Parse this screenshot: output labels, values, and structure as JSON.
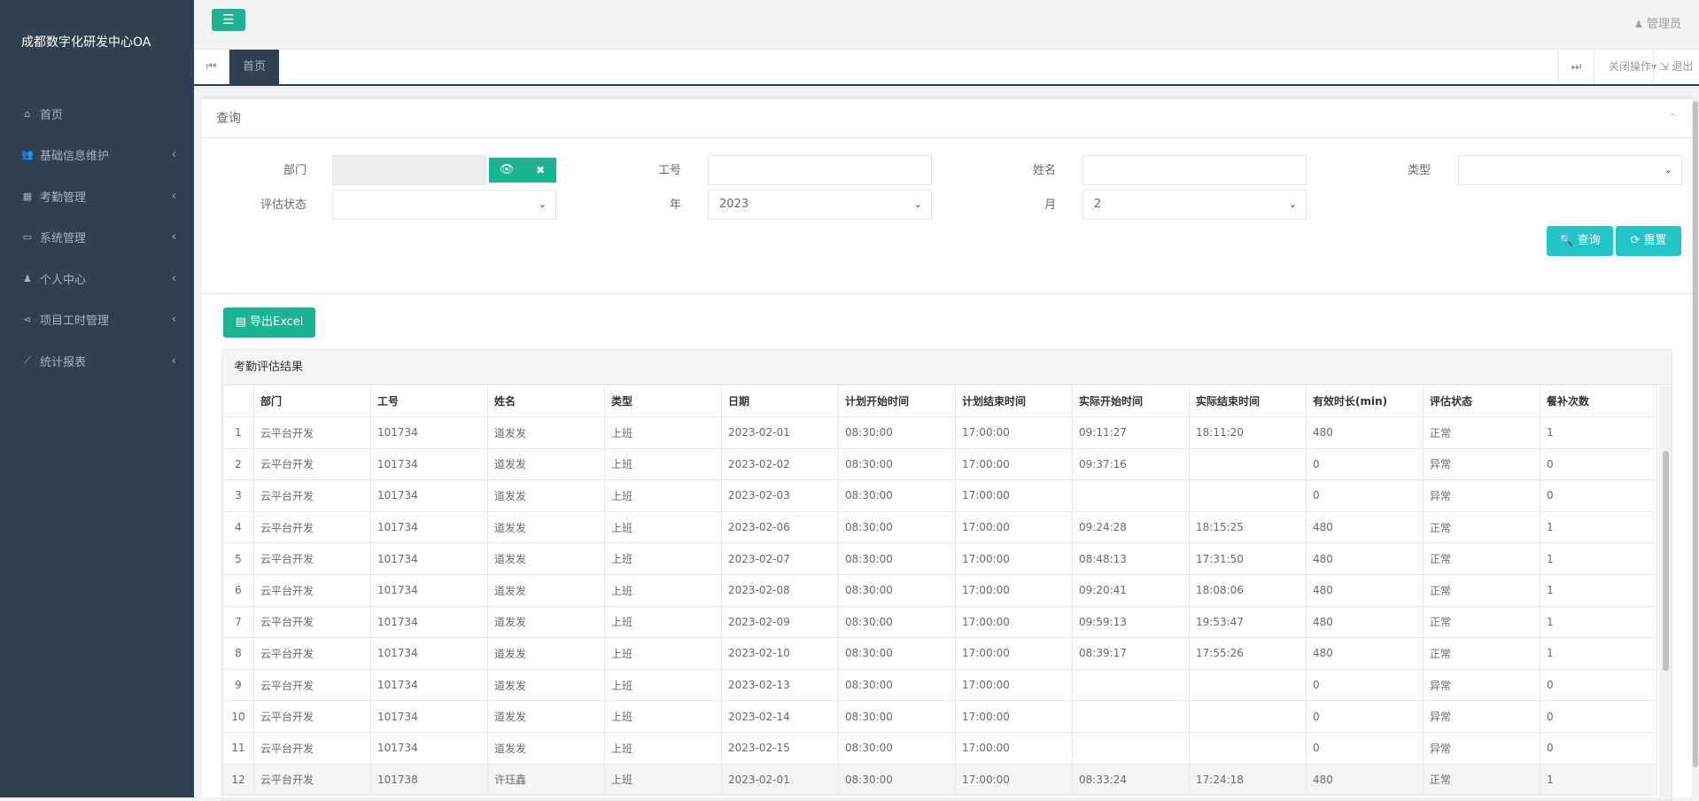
{
  "app": {
    "title": "成都数字化研发中心OA",
    "admin_label": "管理员"
  },
  "sidebar": {
    "items": [
      {
        "icon": "home-icon",
        "glyph": "⌂",
        "label": "首页"
      },
      {
        "icon": "users-icon",
        "glyph": "👥",
        "label": "基础信息维护",
        "arrow": "‹"
      },
      {
        "icon": "calendar-icon",
        "glyph": "▦",
        "label": "考勤管理",
        "arrow": "‹"
      },
      {
        "icon": "desktop-icon",
        "glyph": "▭",
        "label": "系统管理",
        "arrow": "‹"
      },
      {
        "icon": "user-icon",
        "glyph": "♟",
        "label": "个人中心",
        "arrow": "‹"
      },
      {
        "icon": "share-icon",
        "glyph": "⋖",
        "label": "项目工时管理",
        "arrow": "‹"
      },
      {
        "icon": "chart-line-icon",
        "glyph": "⟋",
        "label": "统计报表",
        "arrow": "‹"
      }
    ]
  },
  "tabs": {
    "left_glyph": "⏮",
    "home_label": "首页",
    "right_glyph": "⏭",
    "close_ops_label": "关闭操作▾",
    "logout_label": "⇲ 退出"
  },
  "query": {
    "title": "查询",
    "collapse_glyph": "⌃",
    "dept_label": "部门",
    "dept_value": "",
    "eye_glyph": "👁",
    "clear_glyph": "✖",
    "empno_label": "工号",
    "empno_value": "",
    "name_label": "姓名",
    "name_value": "",
    "type_label": "类型",
    "type_value": "",
    "status_label": "评估状态",
    "status_value": "",
    "year_label": "年",
    "year_value": "2023",
    "month_label": "月",
    "month_value": "2",
    "search_label": "🔍 查询",
    "reset_label": "⟳ 重置"
  },
  "export": {
    "label": "▤ 导出Excel"
  },
  "results": {
    "title": "考勤评估结果",
    "columns": [
      "",
      "部门",
      "工号",
      "姓名",
      "类型",
      "日期",
      "计划开始时间",
      "计划结束时间",
      "实际开始时间",
      "实际结束时间",
      "有效时长(min)",
      "评估状态",
      "餐补次数"
    ],
    "rows": [
      [
        "1",
        "云平台开发",
        "101734",
        "道发发",
        "上班",
        "2023-02-01",
        "08:30:00",
        "17:00:00",
        "09:11:27",
        "18:11:20",
        "480",
        "正常",
        "1"
      ],
      [
        "2",
        "云平台开发",
        "101734",
        "道发发",
        "上班",
        "2023-02-02",
        "08:30:00",
        "17:00:00",
        "09:37:16",
        "",
        "0",
        "异常",
        "0"
      ],
      [
        "3",
        "云平台开发",
        "101734",
        "道发发",
        "上班",
        "2023-02-03",
        "08:30:00",
        "17:00:00",
        "",
        "",
        "0",
        "异常",
        "0"
      ],
      [
        "4",
        "云平台开发",
        "101734",
        "道发发",
        "上班",
        "2023-02-06",
        "08:30:00",
        "17:00:00",
        "09:24:28",
        "18:15:25",
        "480",
        "正常",
        "1"
      ],
      [
        "5",
        "云平台开发",
        "101734",
        "道发发",
        "上班",
        "2023-02-07",
        "08:30:00",
        "17:00:00",
        "08:48:13",
        "17:31:50",
        "480",
        "正常",
        "1"
      ],
      [
        "6",
        "云平台开发",
        "101734",
        "道发发",
        "上班",
        "2023-02-08",
        "08:30:00",
        "17:00:00",
        "09:20:41",
        "18:08:06",
        "480",
        "正常",
        "1"
      ],
      [
        "7",
        "云平台开发",
        "101734",
        "道发发",
        "上班",
        "2023-02-09",
        "08:30:00",
        "17:00:00",
        "09:59:13",
        "19:53:47",
        "480",
        "正常",
        "1"
      ],
      [
        "8",
        "云平台开发",
        "101734",
        "道发发",
        "上班",
        "2023-02-10",
        "08:30:00",
        "17:00:00",
        "08:39:17",
        "17:55:26",
        "480",
        "正常",
        "1"
      ],
      [
        "9",
        "云平台开发",
        "101734",
        "道发发",
        "上班",
        "2023-02-13",
        "08:30:00",
        "17:00:00",
        "",
        "",
        "0",
        "异常",
        "0"
      ],
      [
        "10",
        "云平台开发",
        "101734",
        "道发发",
        "上班",
        "2023-02-14",
        "08:30:00",
        "17:00:00",
        "",
        "",
        "0",
        "异常",
        "0"
      ],
      [
        "11",
        "云平台开发",
        "101734",
        "道发发",
        "上班",
        "2023-02-15",
        "08:30:00",
        "17:00:00",
        "",
        "",
        "0",
        "异常",
        "0"
      ],
      [
        "12",
        "云平台开发",
        "101738",
        "许珏鑫",
        "上班",
        "2023-02-01",
        "08:30:00",
        "17:00:00",
        "08:33:24",
        "17:24:18",
        "480",
        "正常",
        "1"
      ]
    ]
  }
}
